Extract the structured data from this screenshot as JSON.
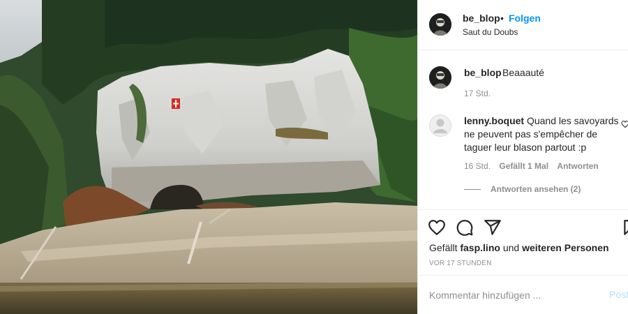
{
  "photo": {
    "alt": "Saut du Doubs cliff",
    "flag_color": "#d52b1e"
  },
  "header": {
    "username": "be_blop",
    "separator": "•",
    "follow_label": "Folgen",
    "location": "Saut du Doubs"
  },
  "caption": {
    "username": "be_blop",
    "text": "Beaaauté",
    "time": "17 Std."
  },
  "comment": {
    "username": "lenny.boquet",
    "text": "Quand les savoyards ne peuvent pas s'empêcher de taguer leur blason partout :p",
    "time": "16 Std.",
    "likes": "Gefällt 1 Mal",
    "reply": "Antworten",
    "view_replies": "Antworten ansehen (2)"
  },
  "actions": {
    "icons": [
      "heart-icon",
      "comment-icon",
      "share-icon",
      "bookmark-icon"
    ],
    "liked_prefix": "Gefällt",
    "liked_user": "fasp.lino",
    "liked_and": "und",
    "liked_others": "weiteren Personen",
    "posted_ago": "VOR 17 STUNDEN"
  },
  "add_comment": {
    "placeholder": "Kommentar hinzufügen ...",
    "post_label": "Posten"
  },
  "colors": {
    "accent": "#0095f6",
    "muted": "#8e8e8e",
    "text": "#262626",
    "border": "#efefef"
  }
}
